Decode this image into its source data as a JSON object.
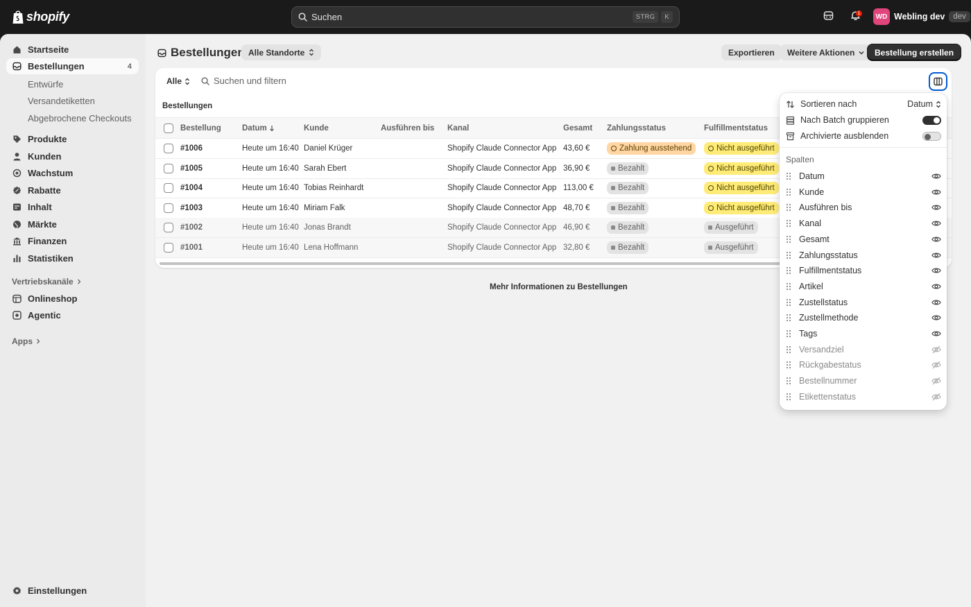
{
  "topbar": {
    "logo_text": "shopify",
    "search_placeholder": "Suchen",
    "shortcut_key1": "STRG",
    "shortcut_key2": "K",
    "notification_count": "1",
    "avatar_initials": "WD",
    "store_name": "Webling dev",
    "store_badge": "dev"
  },
  "sidebar": {
    "items": [
      {
        "label": "Startseite",
        "icon": "home-icon"
      },
      {
        "label": "Bestellungen",
        "icon": "orders-icon",
        "count": "4"
      },
      {
        "label": "Produkte",
        "icon": "tag-icon"
      },
      {
        "label": "Kunden",
        "icon": "person-icon"
      },
      {
        "label": "Wachstum",
        "icon": "target-icon"
      },
      {
        "label": "Rabatte",
        "icon": "discount-icon"
      },
      {
        "label": "Inhalt",
        "icon": "content-icon"
      },
      {
        "label": "Märkte",
        "icon": "globe-icon"
      },
      {
        "label": "Finanzen",
        "icon": "bank-icon"
      },
      {
        "label": "Statistiken",
        "icon": "chart-icon"
      }
    ],
    "sub_items": [
      "Entwürfe",
      "Versandetiketten",
      "Abgebrochene Checkouts"
    ],
    "sales_channels_heading": "Vertriebskanäle",
    "channels": [
      {
        "label": "Onlineshop",
        "icon": "store-icon"
      },
      {
        "label": "Agentic",
        "icon": "agentic-icon"
      }
    ],
    "apps_heading": "Apps",
    "settings_label": "Einstellungen"
  },
  "header": {
    "title": "Bestellungen",
    "location_selector": "Alle Standorte",
    "export_label": "Exportieren",
    "more_actions_label": "Weitere Aktionen",
    "create_label": "Bestellung erstellen"
  },
  "filters": {
    "tab_all": "Alle",
    "search_placeholder": "Suchen und filtern"
  },
  "table": {
    "section_label": "Bestellungen",
    "columns": [
      "Bestellung",
      "Datum",
      "Kunde",
      "Ausführen bis",
      "Kanal",
      "Gesamt",
      "Zahlungsstatus",
      "Fulfillmentstatus"
    ],
    "rows": [
      {
        "order": "#1006",
        "date": "Heute um 16:40",
        "customer": "Daniel Krüger",
        "channel": "Shopify Claude Connector App",
        "total": "43,60 €",
        "payment": "Zahlung ausstehend",
        "payment_type": "attn",
        "fulfillment": "Nicht ausgeführt",
        "fulfillment_type": "warn",
        "muted": false
      },
      {
        "order": "#1005",
        "date": "Heute um 16:40",
        "customer": "Sarah Ebert",
        "channel": "Shopify Claude Connector App",
        "total": "36,90 €",
        "payment": "Bezahlt",
        "payment_type": "done",
        "fulfillment": "Nicht ausgeführt",
        "fulfillment_type": "warn",
        "muted": false
      },
      {
        "order": "#1004",
        "date": "Heute um 16:40",
        "customer": "Tobias Reinhardt",
        "channel": "Shopify Claude Connector App",
        "total": "113,00 €",
        "payment": "Bezahlt",
        "payment_type": "done",
        "fulfillment": "Nicht ausgeführt",
        "fulfillment_type": "warn",
        "muted": false
      },
      {
        "order": "#1003",
        "date": "Heute um 16:40",
        "customer": "Miriam Falk",
        "channel": "Shopify Claude Connector App",
        "total": "48,70 €",
        "payment": "Bezahlt",
        "payment_type": "done",
        "fulfillment": "Nicht ausgeführt",
        "fulfillment_type": "warn",
        "muted": false
      },
      {
        "order": "#1002",
        "date": "Heute um 16:40",
        "customer": "Jonas Brandt",
        "channel": "Shopify Claude Connector App",
        "total": "46,90 €",
        "payment": "Bezahlt",
        "payment_type": "done",
        "fulfillment": "Ausgeführt",
        "fulfillment_type": "done",
        "muted": true
      },
      {
        "order": "#1001",
        "date": "Heute um 16:40",
        "customer": "Lena Hoffmann",
        "channel": "Shopify Claude Connector App",
        "total": "32,80 €",
        "payment": "Bezahlt",
        "payment_type": "done",
        "fulfillment": "Ausgeführt",
        "fulfillment_type": "done",
        "muted": true
      }
    ]
  },
  "more_info_link": "Mehr Informationen zu Bestellungen",
  "popover": {
    "sort_label": "Sortieren nach",
    "sort_value": "Datum",
    "group_label": "Nach Batch gruppieren",
    "group_on": true,
    "archive_label": "Archivierte ausblenden",
    "archive_on": false,
    "columns_heading": "Spalten",
    "columns": [
      {
        "label": "Datum",
        "visible": true
      },
      {
        "label": "Kunde",
        "visible": true
      },
      {
        "label": "Ausführen bis",
        "visible": true
      },
      {
        "label": "Kanal",
        "visible": true
      },
      {
        "label": "Gesamt",
        "visible": true
      },
      {
        "label": "Zahlungsstatus",
        "visible": true
      },
      {
        "label": "Fulfillmentstatus",
        "visible": true
      },
      {
        "label": "Artikel",
        "visible": true
      },
      {
        "label": "Zustellstatus",
        "visible": true
      },
      {
        "label": "Zustellmethode",
        "visible": true
      },
      {
        "label": "Tags",
        "visible": true
      },
      {
        "label": "Versandziel",
        "visible": false
      },
      {
        "label": "Rückgabestatus",
        "visible": false
      },
      {
        "label": "Bestellnummer",
        "visible": false
      },
      {
        "label": "Etikettenstatus",
        "visible": false
      }
    ]
  },
  "colors": {
    "accent": "#005bd3",
    "topbar": "#1a1a1a",
    "attention_badge": "#ffd6a4",
    "warning_badge": "#ffeb78",
    "avatar": "#e0457b"
  }
}
